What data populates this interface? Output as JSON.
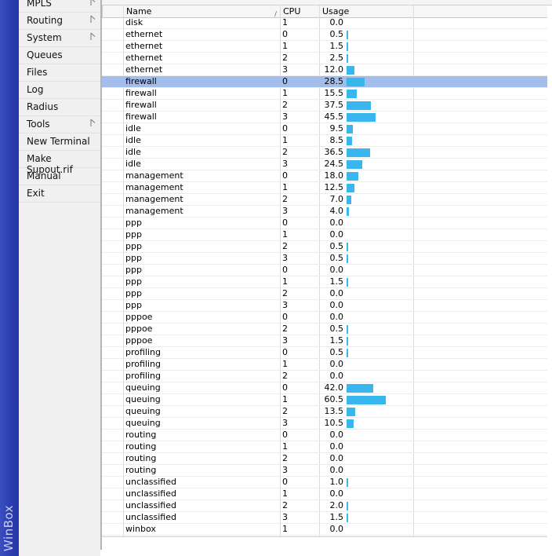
{
  "brand": {
    "name": "WinBox"
  },
  "menu": {
    "items": [
      {
        "label": "MPLS",
        "has_submenu": true
      },
      {
        "label": "Routing",
        "has_submenu": true
      },
      {
        "label": "System",
        "has_submenu": true
      },
      {
        "label": "Queues",
        "has_submenu": false
      },
      {
        "label": "Files",
        "has_submenu": false
      },
      {
        "label": "Log",
        "has_submenu": false
      },
      {
        "label": "Radius",
        "has_submenu": false
      },
      {
        "label": "Tools",
        "has_submenu": true
      },
      {
        "label": "New Terminal",
        "has_submenu": false
      },
      {
        "label": "Make Supout.rif",
        "has_submenu": false
      },
      {
        "label": "Manual",
        "has_submenu": false
      },
      {
        "label": "Exit",
        "has_submenu": false
      }
    ]
  },
  "table": {
    "columns": {
      "name": "Name",
      "cpu": "CPU",
      "usage": "Usage"
    },
    "sort_icon": "sort-arrow-icon",
    "bar_color": "#38b6ee",
    "selected_color": "#a3bdea",
    "selected_row": 5,
    "rows": [
      {
        "name": "disk",
        "cpu": "1",
        "usage": "0.0"
      },
      {
        "name": "ethernet",
        "cpu": "0",
        "usage": "0.5"
      },
      {
        "name": "ethernet",
        "cpu": "1",
        "usage": "1.5"
      },
      {
        "name": "ethernet",
        "cpu": "2",
        "usage": "2.5"
      },
      {
        "name": "ethernet",
        "cpu": "3",
        "usage": "12.0"
      },
      {
        "name": "firewall",
        "cpu": "0",
        "usage": "28.5"
      },
      {
        "name": "firewall",
        "cpu": "1",
        "usage": "15.5"
      },
      {
        "name": "firewall",
        "cpu": "2",
        "usage": "37.5"
      },
      {
        "name": "firewall",
        "cpu": "3",
        "usage": "45.5"
      },
      {
        "name": "idle",
        "cpu": "0",
        "usage": "9.5"
      },
      {
        "name": "idle",
        "cpu": "1",
        "usage": "8.5"
      },
      {
        "name": "idle",
        "cpu": "2",
        "usage": "36.5"
      },
      {
        "name": "idle",
        "cpu": "3",
        "usage": "24.5"
      },
      {
        "name": "management",
        "cpu": "0",
        "usage": "18.0"
      },
      {
        "name": "management",
        "cpu": "1",
        "usage": "12.5"
      },
      {
        "name": "management",
        "cpu": "2",
        "usage": "7.0"
      },
      {
        "name": "management",
        "cpu": "3",
        "usage": "4.0"
      },
      {
        "name": "ppp",
        "cpu": "0",
        "usage": "0.0"
      },
      {
        "name": "ppp",
        "cpu": "1",
        "usage": "0.0"
      },
      {
        "name": "ppp",
        "cpu": "2",
        "usage": "0.5"
      },
      {
        "name": "ppp",
        "cpu": "3",
        "usage": "0.5"
      },
      {
        "name": "ppp",
        "cpu": "0",
        "usage": "0.0"
      },
      {
        "name": "ppp",
        "cpu": "1",
        "usage": "1.5"
      },
      {
        "name": "ppp",
        "cpu": "2",
        "usage": "0.0"
      },
      {
        "name": "ppp",
        "cpu": "3",
        "usage": "0.0"
      },
      {
        "name": "pppoe",
        "cpu": "0",
        "usage": "0.0"
      },
      {
        "name": "pppoe",
        "cpu": "2",
        "usage": "0.5"
      },
      {
        "name": "pppoe",
        "cpu": "3",
        "usage": "1.5"
      },
      {
        "name": "profiling",
        "cpu": "0",
        "usage": "0.5"
      },
      {
        "name": "profiling",
        "cpu": "1",
        "usage": "0.0"
      },
      {
        "name": "profiling",
        "cpu": "2",
        "usage": "0.0"
      },
      {
        "name": "queuing",
        "cpu": "0",
        "usage": "42.0"
      },
      {
        "name": "queuing",
        "cpu": "1",
        "usage": "60.5"
      },
      {
        "name": "queuing",
        "cpu": "2",
        "usage": "13.5"
      },
      {
        "name": "queuing",
        "cpu": "3",
        "usage": "10.5"
      },
      {
        "name": "routing",
        "cpu": "0",
        "usage": "0.0"
      },
      {
        "name": "routing",
        "cpu": "1",
        "usage": "0.0"
      },
      {
        "name": "routing",
        "cpu": "2",
        "usage": "0.0"
      },
      {
        "name": "routing",
        "cpu": "3",
        "usage": "0.0"
      },
      {
        "name": "unclassified",
        "cpu": "0",
        "usage": "1.0"
      },
      {
        "name": "unclassified",
        "cpu": "1",
        "usage": "0.0"
      },
      {
        "name": "unclassified",
        "cpu": "2",
        "usage": "2.0"
      },
      {
        "name": "unclassified",
        "cpu": "3",
        "usage": "1.5"
      },
      {
        "name": "winbox",
        "cpu": "1",
        "usage": "0.0"
      }
    ]
  }
}
